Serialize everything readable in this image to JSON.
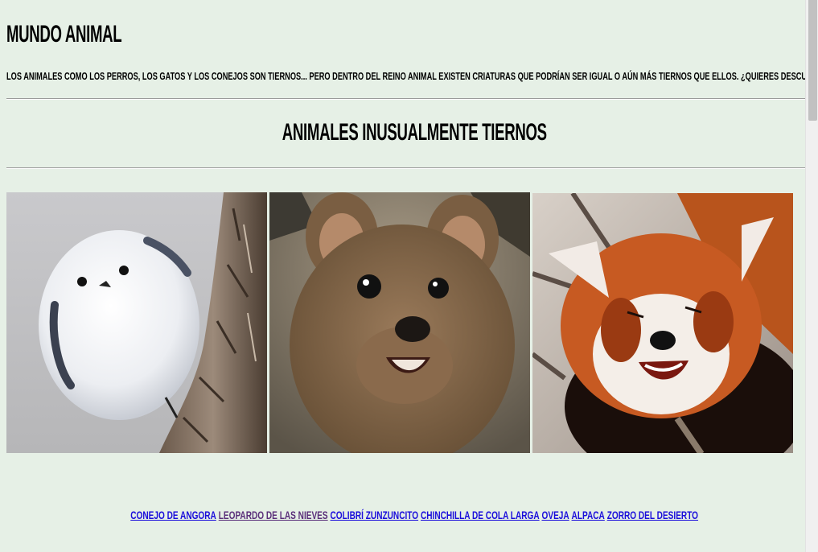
{
  "header": {
    "title": "Mundo Animal",
    "intro": "Los animales como los perros, los gatos y los conejos son tiernos... pero dentro del reino animal existen criaturas que podrían ser igual o aún más tiernos que ellos. ¿Quieres descubrilos?"
  },
  "section": {
    "title": "Animales inusualmente tiernos"
  },
  "gallery": {
    "photos": [
      {
        "subject": "long-tailed-tit"
      },
      {
        "subject": "quokka"
      },
      {
        "subject": "red-panda"
      }
    ]
  },
  "links": [
    {
      "label": "Conejo de Angora",
      "visited": false
    },
    {
      "label": "Leopardo de las nieves",
      "visited": true
    },
    {
      "label": "Colibrí zunzuncito",
      "visited": false
    },
    {
      "label": "Chinchilla de cola larga",
      "visited": false
    },
    {
      "label": "Oveja",
      "visited": false
    },
    {
      "label": "Alpaca",
      "visited": false
    },
    {
      "label": "Zorro del desierto",
      "visited": false
    }
  ],
  "colors": {
    "background": "#e6f0e6",
    "link": "#1a0ddb",
    "link_visited": "#5a2f7a"
  }
}
